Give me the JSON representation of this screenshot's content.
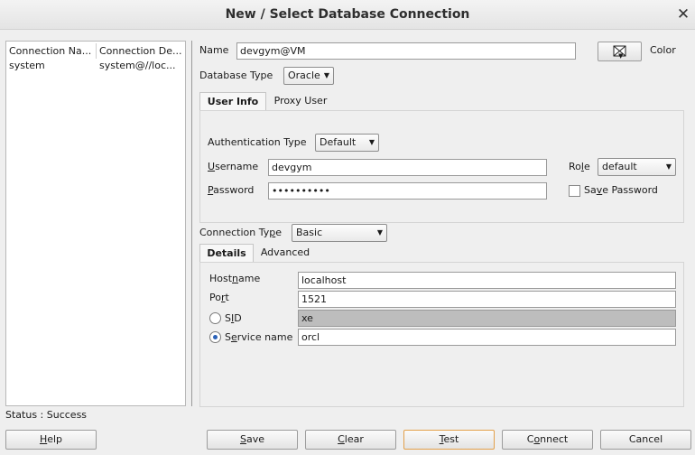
{
  "dialog": {
    "title": "New / Select Database Connection",
    "close_icon": "close-icon"
  },
  "connections": {
    "headers": [
      "Connection Na...",
      "Connection De..."
    ],
    "rows": [
      {
        "name": "system",
        "details": "system@//loc..."
      }
    ]
  },
  "name": {
    "label": "Name",
    "value": "devgym@VM"
  },
  "color": {
    "label": "Color"
  },
  "database_type": {
    "label": "Database Type",
    "value": "Oracle"
  },
  "tabs_main": [
    "User Info",
    "Proxy User"
  ],
  "auth": {
    "label": "Authentication Type",
    "value": "Default"
  },
  "username": {
    "label_pre": "",
    "label_u": "U",
    "label_post": "sername",
    "value": "devgym"
  },
  "password": {
    "label_pre": "",
    "label_u": "P",
    "label_post": "assword",
    "value": "••••••••••"
  },
  "role": {
    "label_pre": "Ro",
    "label_u": "l",
    "label_post": "e",
    "value": "default"
  },
  "save_password": {
    "label_pre": "Sa",
    "label_u": "v",
    "label_post": "e Password",
    "checked": false
  },
  "connection_type": {
    "label_pre": "Connection Ty",
    "label_u": "p",
    "label_post": "e",
    "value": "Basic"
  },
  "tabs_conn": [
    "Details",
    "Advanced"
  ],
  "hostname": {
    "label_pre": "Host",
    "label_u": "n",
    "label_post": "ame",
    "value": "localhost"
  },
  "port": {
    "label_pre": "Po",
    "label_u": "r",
    "label_post": "t",
    "value": "1521"
  },
  "sid": {
    "label_pre": "S",
    "label_u": "I",
    "label_post": "D",
    "value": "xe",
    "selected": false
  },
  "service": {
    "label_pre": "S",
    "label_u": "e",
    "label_post": "rvice name",
    "value": "orcl",
    "selected": true
  },
  "status": {
    "text": "Status : Success"
  },
  "buttons": {
    "help": {
      "pre": "",
      "u": "H",
      "post": "elp"
    },
    "save": {
      "pre": "",
      "u": "S",
      "post": "ave"
    },
    "clear": {
      "pre": "",
      "u": "C",
      "post": "lear"
    },
    "test": {
      "pre": "",
      "u": "T",
      "post": "est"
    },
    "connect": {
      "pre": "C",
      "u": "o",
      "post": "nnect"
    },
    "cancel": {
      "pre": "Cancel",
      "u": "",
      "post": ""
    }
  }
}
